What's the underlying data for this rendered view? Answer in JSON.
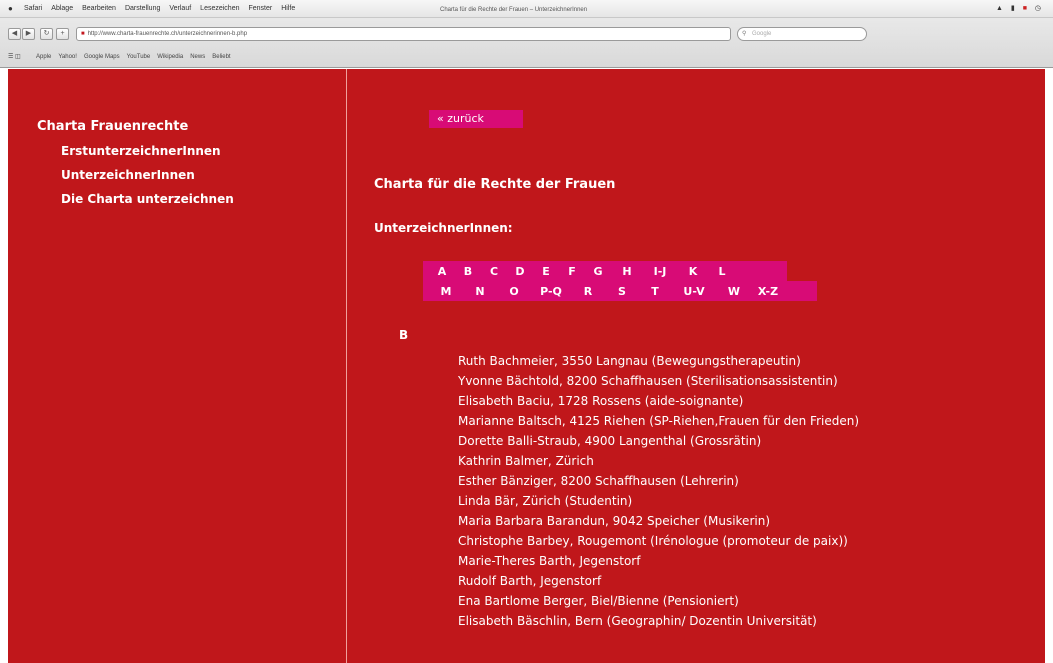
{
  "browser": {
    "apple": "",
    "menus": [
      "Safari",
      "Ablage",
      "Bearbeiten",
      "Darstellung",
      "Verlauf",
      "Lesezeichen",
      "Fenster",
      "Hilfe"
    ],
    "window_title": "Charta für die Rechte der Frauen – UnterzeichnerInnen",
    "url": "http://www.charta-frauenrechte.ch/unterzeichnerinnen-b.php",
    "search_placeholder": "Google",
    "bookmarks": [
      "Apple",
      "Yahoo!",
      "Google Maps",
      "YouTube",
      "Wikipedia",
      "News",
      "Beliebt"
    ]
  },
  "sidebar": {
    "title": "Charta Frauenrechte",
    "items": [
      {
        "label": "ErstunterzeichnerInnen"
      },
      {
        "label": "UnterzeichnerInnen"
      },
      {
        "label": "Die Charta unterzeichnen"
      }
    ]
  },
  "main": {
    "back_label": "« zurück",
    "title": "Charta für die Rechte der Frauen",
    "subheading": "UnterzeichnerInnen:",
    "letters_row1": [
      "A",
      "B",
      "C",
      "D",
      "E",
      "F",
      "G",
      "H",
      "I-J",
      "K",
      "L"
    ],
    "letters_row2": [
      "M",
      "N",
      "O",
      "P-Q",
      "R",
      "S",
      "T",
      "U-V",
      "W",
      "X-Z"
    ],
    "section_letter": "B",
    "signers": [
      "Ruth Bachmeier, 3550 Langnau (Bewegungstherapeutin)",
      "Yvonne Bächtold, 8200 Schaffhausen (Sterilisationsassistentin)",
      "Elisabeth Baciu, 1728 Rossens (aide-soignante)",
      "Marianne Baltsch, 4125 Riehen (SP-Riehen,Frauen für den Frieden)",
      "Dorette Balli-Straub, 4900 Langenthal (Grossrätin)",
      "Kathrin Balmer, Zürich",
      "Esther Bänziger, 8200 Schaffhausen (Lehrerin)",
      "Linda Bär, Zürich (Studentin)",
      "Maria Barbara Barandun, 9042 Speicher (Musikerin)",
      "Christophe Barbey, Rougemont (Irénologue (promoteur de paix))",
      "Marie-Theres Barth, Jegenstorf",
      "Rudolf Barth, Jegenstorf",
      "Ena Bartlome Berger, Biel/Bienne (Pensioniert)",
      "Elisabeth Bäschlin, Bern (Geographin/ Dozentin Universität)"
    ]
  },
  "colors": {
    "page_red": "#c0171b",
    "accent_pink": "#d80b76",
    "text": "#ffffff"
  }
}
